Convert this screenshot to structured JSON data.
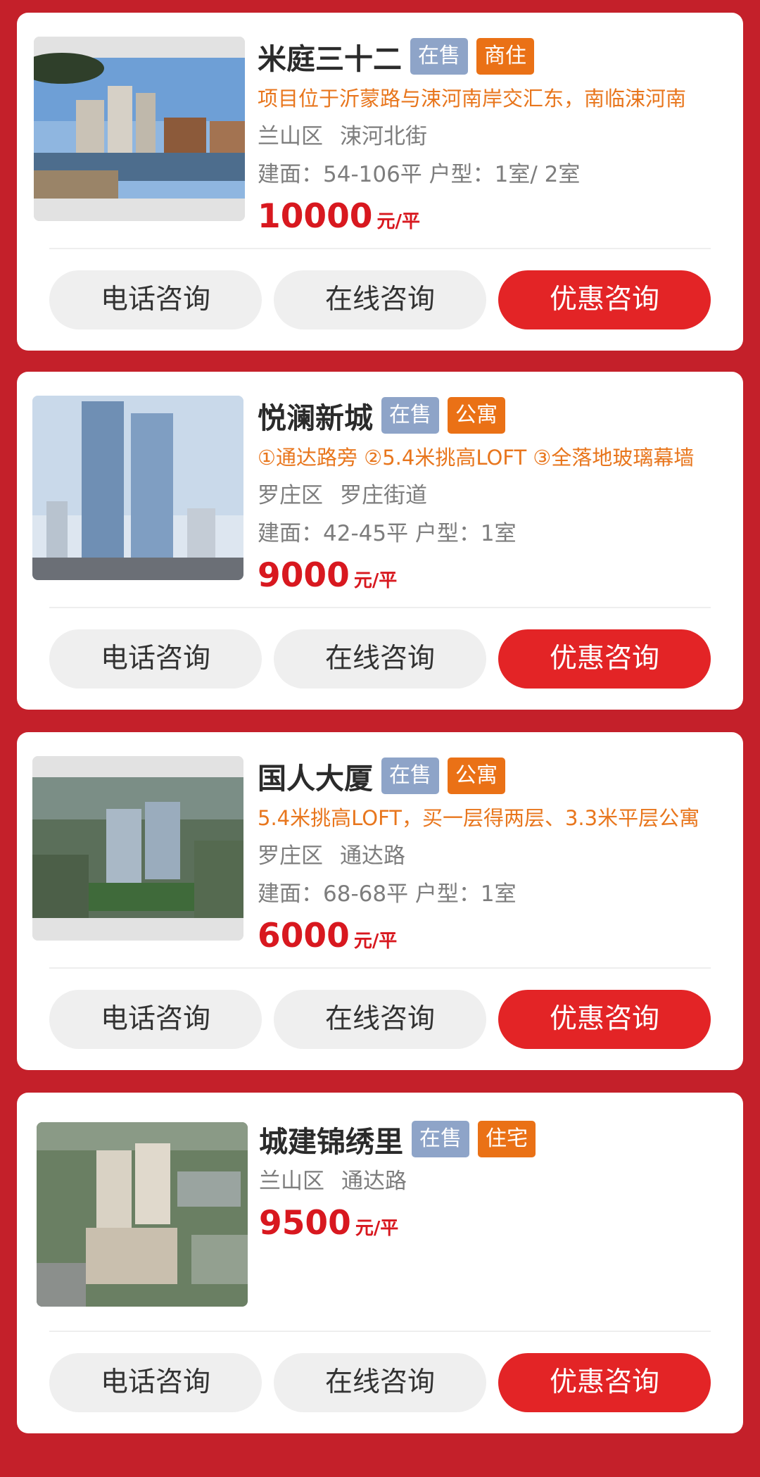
{
  "buttons": {
    "phone": "电话咨询",
    "online": "在线咨询",
    "promo": "优惠咨询"
  },
  "price_unit": "元/平",
  "properties": [
    {
      "name": "米庭三十二",
      "status": "在售",
      "type": "商住",
      "description": "项目位于沂蒙路与涑河南岸交汇东，南临涑河南",
      "district": "兰山区",
      "street": "涑河北街",
      "specs": "建面：54-106平 户型：1室/ 2室",
      "price": "10000"
    },
    {
      "name": "悦澜新城",
      "status": "在售",
      "type": "公寓",
      "description": "①通达路旁 ②5.4米挑高LOFT ③全落地玻璃幕墙",
      "district": "罗庄区",
      "street": "罗庄街道",
      "specs": "建面：42-45平 户型：1室",
      "price": "9000"
    },
    {
      "name": "国人大厦",
      "status": "在售",
      "type": "公寓",
      "description": "5.4米挑高LOFT，买一层得两层、3.3米平层公寓",
      "district": "罗庄区",
      "street": "通达路",
      "specs": "建面：68-68平 户型：1室",
      "price": "6000"
    },
    {
      "name": "城建锦绣里",
      "status": "在售",
      "type": "住宅",
      "district": "兰山区",
      "street": "通达路",
      "price": "9500"
    }
  ]
}
